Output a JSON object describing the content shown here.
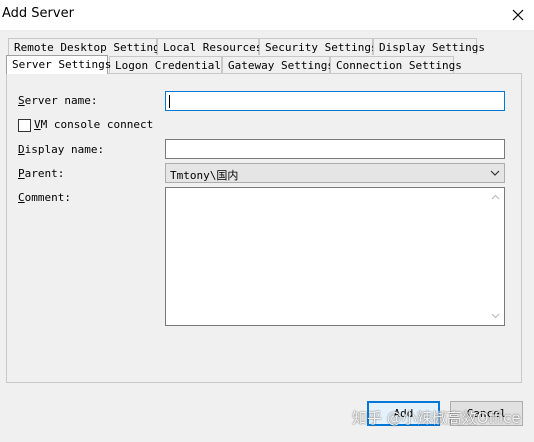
{
  "window": {
    "title": "Add Server"
  },
  "tabs": {
    "row1": [
      "Remote Desktop Settings",
      "Local Resources",
      "Security Settings",
      "Display Settings"
    ],
    "row2": [
      "Server Settings",
      "Logon Credentials",
      "Gateway Settings",
      "Connection Settings"
    ],
    "active": "Server Settings"
  },
  "form": {
    "server_name": {
      "label_key": "S",
      "label_rest": "erver name:",
      "value": ""
    },
    "vm_console": {
      "label_key": "V",
      "label_rest": "M console connect",
      "checked": false
    },
    "display_name": {
      "label_key": "D",
      "label_rest": "isplay name:",
      "value": ""
    },
    "parent": {
      "label_key": "P",
      "label_rest": "arent:",
      "value": "Tmtony\\国内"
    },
    "comment": {
      "label_key": "C",
      "label_rest": "omment:",
      "value": ""
    }
  },
  "buttons": {
    "add": "Add",
    "cancel": "Cancel"
  },
  "watermark": "知乎 @小辣椒高效Office",
  "colors": {
    "focus_border": "#0078d7",
    "window_bg": "#f0f0f0",
    "title_bg": "#ffffff"
  }
}
